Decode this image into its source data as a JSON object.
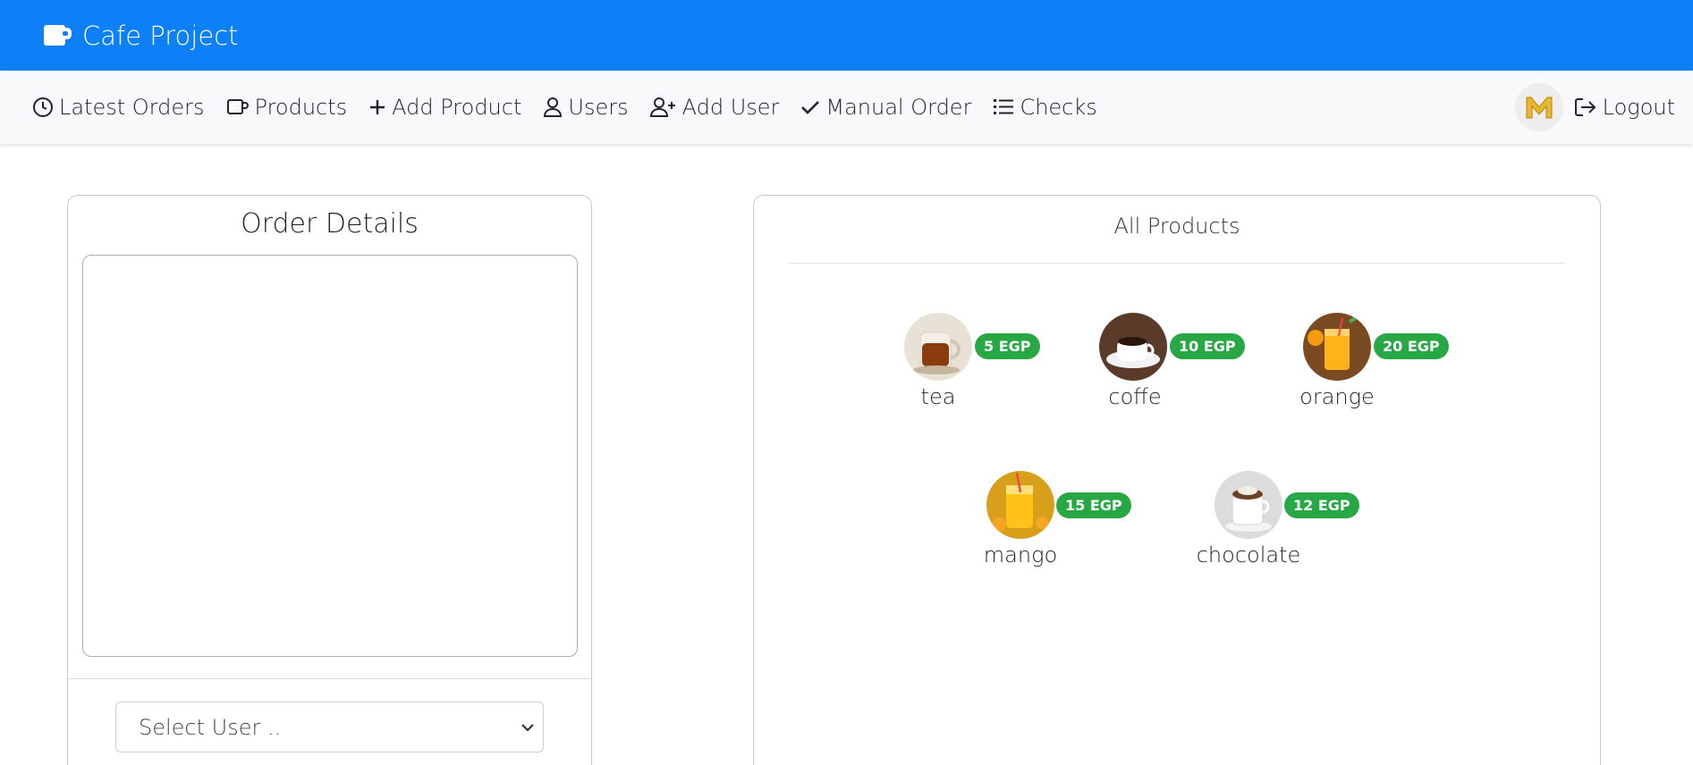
{
  "header": {
    "brand": "Cafe Project"
  },
  "nav": {
    "items": [
      {
        "label": "Latest Orders",
        "icon": "clock-icon"
      },
      {
        "label": "Products",
        "icon": "cup-icon"
      },
      {
        "label": "Add Product",
        "icon": "plus-icon"
      },
      {
        "label": "Users",
        "icon": "person-icon"
      },
      {
        "label": "Add User",
        "icon": "person-plus-icon"
      },
      {
        "label": "Manual Order",
        "icon": "check-icon"
      },
      {
        "label": "Checks",
        "icon": "list-icon"
      }
    ],
    "avatar_letter": "M",
    "logout_label": "Logout"
  },
  "order": {
    "title": "Order Details",
    "select_user_placeholder": "Select User .."
  },
  "products": {
    "title": "All Products",
    "items": [
      {
        "name": "tea",
        "price": "5 EGP"
      },
      {
        "name": "coffe",
        "price": "10 EGP"
      },
      {
        "name": "orange",
        "price": "20 EGP"
      },
      {
        "name": "mango",
        "price": "15 EGP"
      },
      {
        "name": "chocolate",
        "price": "12 EGP"
      }
    ]
  },
  "colors": {
    "topbar": "#0d7ff7",
    "navbar": "#f8f9fa",
    "badge": "#28a745",
    "avatar_letter": "#e8b630"
  }
}
